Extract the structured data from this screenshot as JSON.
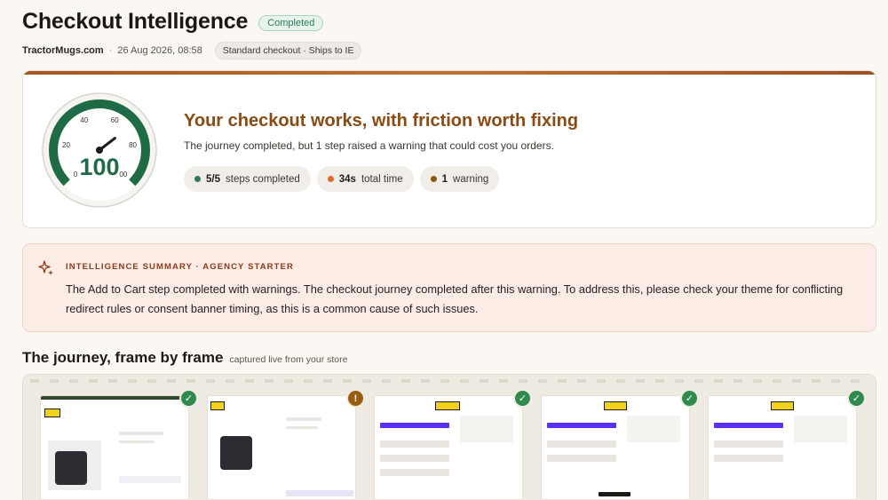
{
  "header": {
    "title": "Checkout Intelligence",
    "status": "Completed",
    "store": "TractorMugs.com",
    "timestamp": "26 Aug 2026, 08:58",
    "separator": "·",
    "mode": "Standard checkout · Ships to IE"
  },
  "score": {
    "value": "100",
    "gauge_ticks": [
      "0",
      "20",
      "40",
      "60",
      "80",
      "00"
    ],
    "gauge_fraction": 1.0,
    "verdict": "Your checkout works, with friction worth fixing",
    "subtitle": "The journey completed, but 1 step raised a warning that could cost you orders.",
    "stats": [
      {
        "value": "5/5",
        "label": "steps completed",
        "color": "#2f7a55"
      },
      {
        "value": "34s",
        "label": "total time",
        "color": "#e06a2c"
      },
      {
        "value": "1",
        "label": "warning",
        "color": "#8a5a10"
      }
    ]
  },
  "summary": {
    "label": "INTELLIGENCE SUMMARY · AGENCY STARTER",
    "text": "The Add to Cart step completed with warnings. The checkout journey completed after this warning. To address this, please check your theme for conflicting redirect rules or consent banner timing, as this is a common cause of such issues."
  },
  "journey": {
    "title": "The journey, frame by frame",
    "subtitle": "captured live from your store",
    "frames": [
      {
        "status": "ok",
        "icon": "check-icon",
        "glyph": "✓"
      },
      {
        "status": "warn",
        "icon": "warning-icon",
        "glyph": "!"
      },
      {
        "status": "ok",
        "icon": "check-icon",
        "glyph": "✓"
      },
      {
        "status": "ok",
        "icon": "check-icon",
        "glyph": "✓"
      },
      {
        "status": "ok",
        "icon": "check-icon",
        "glyph": "✓"
      }
    ]
  },
  "colors": {
    "accent": "#8a4a12",
    "success": "#2f8a4e",
    "warning": "#9a5d10",
    "gauge": "#1f6b45"
  }
}
